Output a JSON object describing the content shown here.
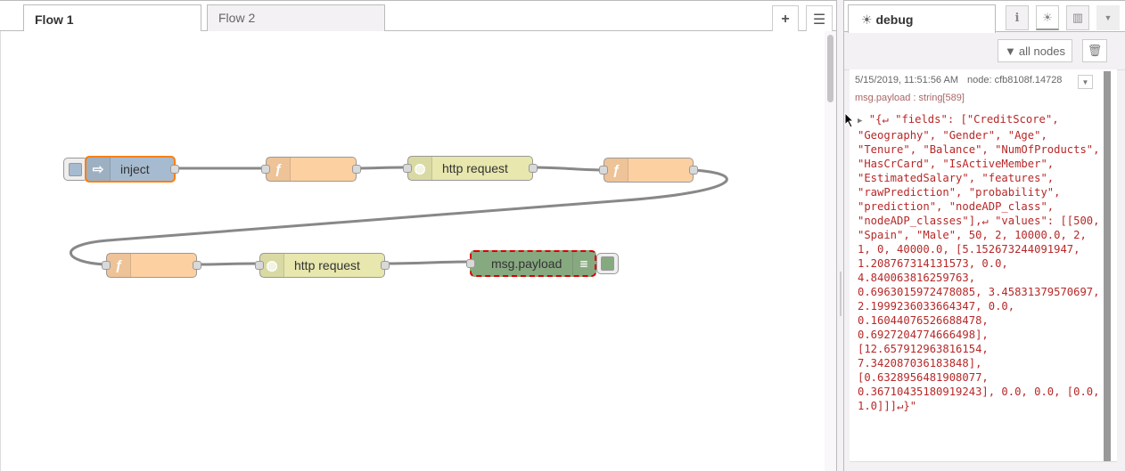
{
  "workspace": {
    "tabs": [
      {
        "label": "Flow 1",
        "active": true
      },
      {
        "label": "Flow 2",
        "active": false
      }
    ],
    "add_flow_icon": "plus-icon",
    "flow_list_icon": "list-icon"
  },
  "flow": {
    "nodes": [
      {
        "id": "inject",
        "type": "inject",
        "label": "inject",
        "color": "#a6bbcf",
        "icon": "arrow-right-icon",
        "selected": true
      },
      {
        "id": "func1",
        "type": "function",
        "label": "",
        "color": "#fdd0a2",
        "icon": "function-icon"
      },
      {
        "id": "http1",
        "type": "http request",
        "label": "http request",
        "color": "#e7e7ae",
        "icon": "globe-icon"
      },
      {
        "id": "func2",
        "type": "function",
        "label": "",
        "color": "#fdd0a2",
        "icon": "function-icon"
      },
      {
        "id": "func3",
        "type": "function",
        "label": "",
        "color": "#fdd0a2",
        "icon": "function-icon"
      },
      {
        "id": "http2",
        "type": "http request",
        "label": "http request",
        "color": "#e7e7ae",
        "icon": "globe-icon"
      },
      {
        "id": "debug",
        "type": "debug",
        "label": "msg.payload",
        "color": "#87a980",
        "icon": "list-lines-icon",
        "changed": true
      }
    ],
    "wires": [
      [
        "inject",
        "func1"
      ],
      [
        "func1",
        "http1"
      ],
      [
        "http1",
        "func2"
      ],
      [
        "func2",
        "func3"
      ],
      [
        "func3",
        "http2"
      ],
      [
        "http2",
        "debug"
      ]
    ]
  },
  "sidebar": {
    "tab_label": "debug",
    "tab_icon": "bug-icon",
    "buttons": [
      "info-icon",
      "bug-icon",
      "chart-icon",
      "chevron-down-icon"
    ],
    "filter_label": "all nodes",
    "filter_icon": "filter-icon",
    "clear_icon": "trash-icon",
    "message": {
      "timestamp": "5/15/2019, 11:51:56 AM",
      "node": "node: cfb8108f.14728",
      "topic": "msg.payload : string[589]",
      "payload": "\"{↵ \"fields\": [\"CreditScore\", \"Geography\", \"Gender\", \"Age\", \"Tenure\", \"Balance\", \"NumOfProducts\", \"HasCrCard\", \"IsActiveMember\", \"EstimatedSalary\", \"features\", \"rawPrediction\", \"probability\", \"prediction\", \"nodeADP_class\", \"nodeADP_classes\"],↵ \"values\": [[500, \"Spain\", \"Male\", 50, 2, 10000.0, 2, 1, 0, 40000.0, [5.152673244091947, 1.208767314131573, 0.0, 4.840063816259763, 0.6963015972478085, 3.45831379570697, 2.1999236033664347, 0.0, 0.16044076526688478, 0.6927204774666498], [12.657912963816154, 7.342087036183848], [0.6328956481908077, 0.36710435180919243], 0.0, 0.0, [0.0, 1.0]]]↵}\""
    }
  }
}
